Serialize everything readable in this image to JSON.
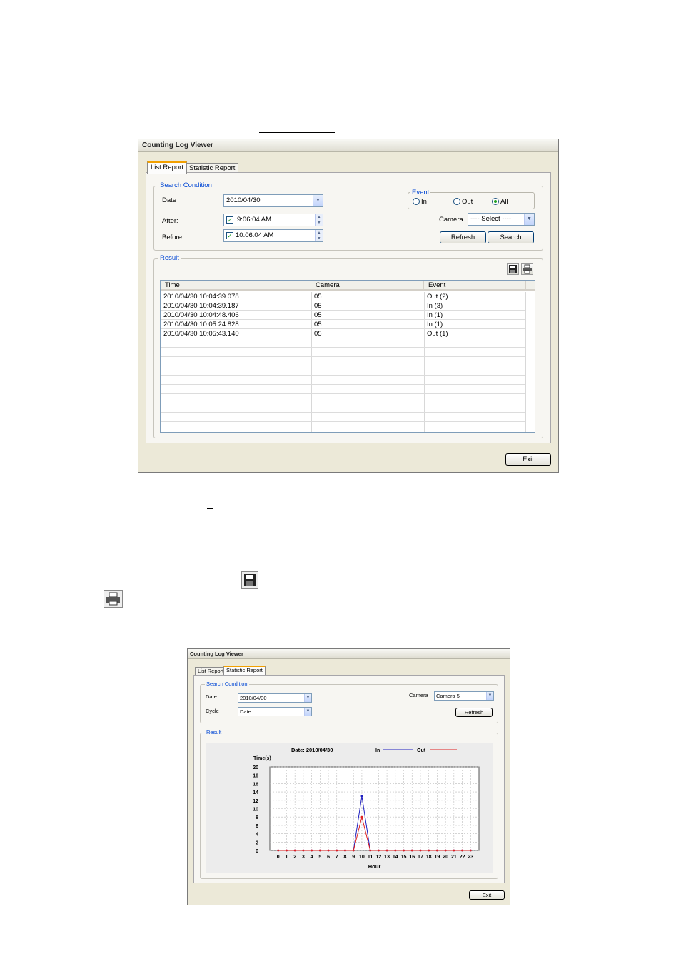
{
  "viewer1": {
    "title": "Counting Log Viewer",
    "tabs": [
      "List Report",
      "Statistic Report"
    ],
    "search_condition_label": "Search Condition",
    "date_label": "Date",
    "date_value": "2010/04/30",
    "after_label": "After:",
    "after_value": "9:06:04 AM",
    "before_label": "Before:",
    "before_value": "10:06:04 AM",
    "event_label": "Event",
    "event_options": [
      "In",
      "Out",
      "All"
    ],
    "event_selected": "All",
    "camera_label": "Camera",
    "camera_value": "---- Select ----",
    "refresh_label": "Refresh",
    "search_label": "Search",
    "result_label": "Result",
    "columns": [
      "Time",
      "Camera",
      "Event"
    ],
    "rows": [
      {
        "time": "2010/04/30 10:04:39.078",
        "camera": "05",
        "event": "Out (2)"
      },
      {
        "time": "2010/04/30 10:04:39.187",
        "camera": "05",
        "event": "In (3)"
      },
      {
        "time": "2010/04/30 10:04:48.406",
        "camera": "05",
        "event": "In (1)"
      },
      {
        "time": "2010/04/30 10:05:24.828",
        "camera": "05",
        "event": "In (1)"
      },
      {
        "time": "2010/04/30 10:05:43.140",
        "camera": "05",
        "event": "Out (1)"
      }
    ],
    "exit_label": "Exit",
    "icons": [
      "save-icon",
      "print-icon"
    ]
  },
  "viewer2": {
    "title": "Counting Log Viewer",
    "tabs": [
      "List Report",
      "Statistic Report"
    ],
    "search_condition_label": "Search Condition",
    "date_label": "Date",
    "date_value": "2010/04/30",
    "cycle_label": "Cycle",
    "cycle_value": "Date",
    "camera_label": "Camera",
    "camera_value": "Camera 5",
    "refresh_label": "Refresh",
    "result_label": "Result",
    "exit_label": "Exit"
  },
  "chart_data": {
    "type": "line",
    "title": "Date: 2010/04/30",
    "xlabel": "Hour",
    "ylabel": "Time(s)",
    "x": [
      0,
      1,
      2,
      3,
      4,
      5,
      6,
      7,
      8,
      9,
      10,
      11,
      12,
      13,
      14,
      15,
      16,
      17,
      18,
      19,
      20,
      21,
      22,
      23
    ],
    "yticks": [
      0,
      2,
      4,
      6,
      8,
      10,
      12,
      14,
      16,
      18,
      20
    ],
    "ylim": [
      0,
      20
    ],
    "grid": true,
    "legend_position": "top",
    "series": [
      {
        "name": "In",
        "color": "#2020c0",
        "values": [
          0,
          0,
          0,
          0,
          0,
          0,
          0,
          0,
          0,
          0,
          13,
          0,
          0,
          0,
          0,
          0,
          0,
          0,
          0,
          0,
          0,
          0,
          0,
          0
        ]
      },
      {
        "name": "Out",
        "color": "#e02020",
        "values": [
          0,
          0,
          0,
          0,
          0,
          0,
          0,
          0,
          0,
          0,
          8,
          0,
          0,
          0,
          0,
          0,
          0,
          0,
          0,
          0,
          0,
          0,
          0,
          0
        ]
      }
    ]
  }
}
